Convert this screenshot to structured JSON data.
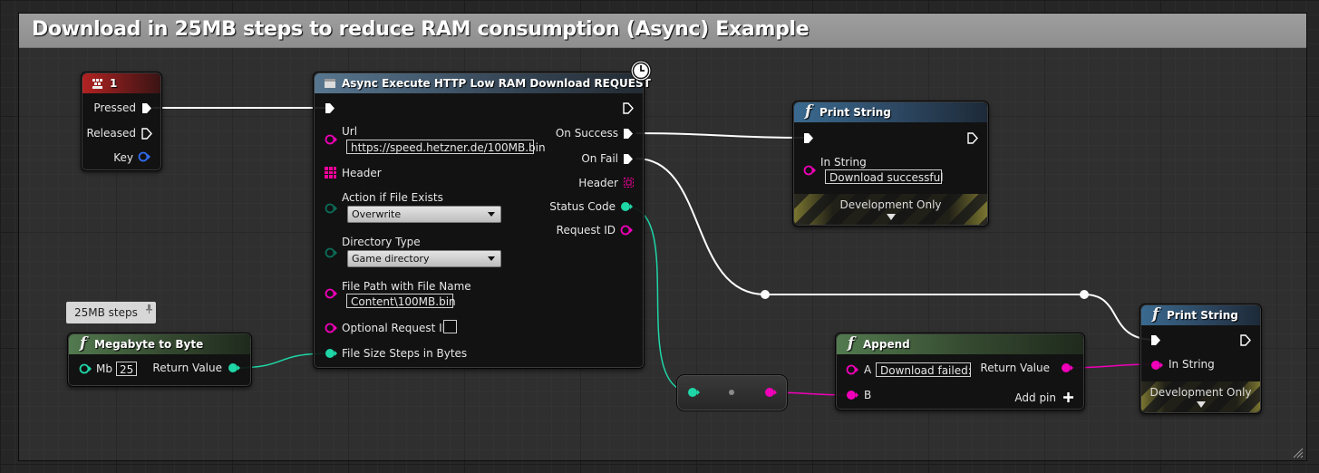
{
  "comment": {
    "title": "Download in 25MB steps to reduce RAM consumption (Async) Example"
  },
  "key_event": {
    "title": "1",
    "pins": {
      "pressed": "Pressed",
      "released": "Released",
      "key": "Key"
    }
  },
  "async_node": {
    "title": "Async Execute HTTP Low RAM Download REQUEST",
    "url_label": "Url",
    "url_value": "https://speed.hetzner.de/100MB.bin",
    "header_label": "Header",
    "action_label": "Action if File Exists",
    "action_value": "Overwrite",
    "dirtype_label": "Directory Type",
    "dirtype_value": "Game directory",
    "filepath_label": "File Path with File Name",
    "filepath_value": "Content\\100MB.bin",
    "optreq_label": "Optional Request ID",
    "steps_label": "File Size Steps in Bytes",
    "outputs": {
      "on_success": "On Success",
      "on_fail": "On Fail",
      "header": "Header",
      "status_code": "Status Code",
      "request_id": "Request ID"
    }
  },
  "print_success": {
    "title": "Print String",
    "in_string_label": "In String",
    "in_string_value": "Download successful",
    "dev_only": "Development Only"
  },
  "print_fail": {
    "title": "Print String",
    "in_string_label": "In String",
    "dev_only": "Development Only"
  },
  "megabyte_node": {
    "title": "Megabyte to Byte",
    "mb_label": "Mb",
    "mb_value": "25",
    "return_label": "Return Value"
  },
  "tooltip": {
    "text": "25MB steps"
  },
  "append_node": {
    "title": "Append",
    "a_label": "A",
    "a_value": "Download failed:",
    "b_label": "B",
    "return_label": "Return Value",
    "add_pin": "Add pin"
  },
  "colors": {
    "exec": "#ffffff",
    "string_pin": "#f000b8",
    "int_pin": "#1ed6a6",
    "struct_pin": "#0d3fb8",
    "enum_pin": "#0b5a4c",
    "map_pin": "#f00098"
  },
  "icons": [
    "keyboard-icon",
    "clock-icon",
    "function-icon",
    "add-pin-icon",
    "pin-tooltip-icon"
  ]
}
